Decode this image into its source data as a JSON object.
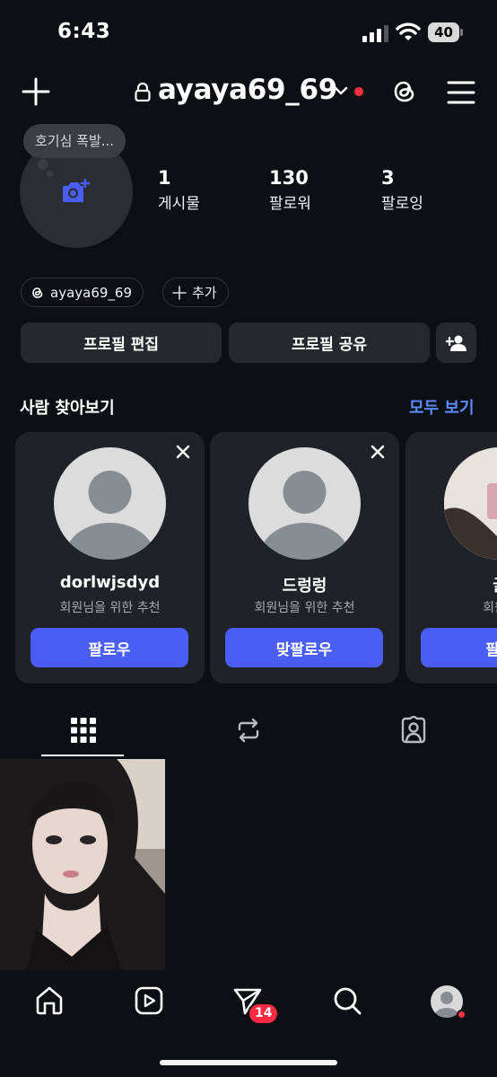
{
  "status_bar": {
    "time": "6:43",
    "battery": "40"
  },
  "header": {
    "username": "ayaya69_69"
  },
  "profile": {
    "note": "호기심 폭발...",
    "stats": [
      {
        "value": "1",
        "label": "게시물"
      },
      {
        "value": "130",
        "label": "팔로워"
      },
      {
        "value": "3",
        "label": "팔로잉"
      }
    ],
    "threads_pill": "ayaya69_69",
    "add_pill": "추가"
  },
  "actions": {
    "edit": "프로필 편집",
    "share": "프로필 공유"
  },
  "suggestions": {
    "title": "사람 찾아보기",
    "see_all": "모두 보기",
    "cards": [
      {
        "name": "dorlwjsdyd",
        "subtitle": "회원님을 위한 추천",
        "button": "팔로우"
      },
      {
        "name": "드렁렁",
        "subtitle": "회원님을 위한 추천",
        "button": "맞팔로우"
      },
      {
        "name": "굴",
        "subtitle": "회원님",
        "button": "팔로"
      }
    ]
  },
  "bottom_nav": {
    "messages_badge": "14"
  },
  "colors": {
    "accent": "#4a5ef5",
    "link": "#5b8cff",
    "badge": "#ff2a41",
    "background": "#0c0f14"
  }
}
